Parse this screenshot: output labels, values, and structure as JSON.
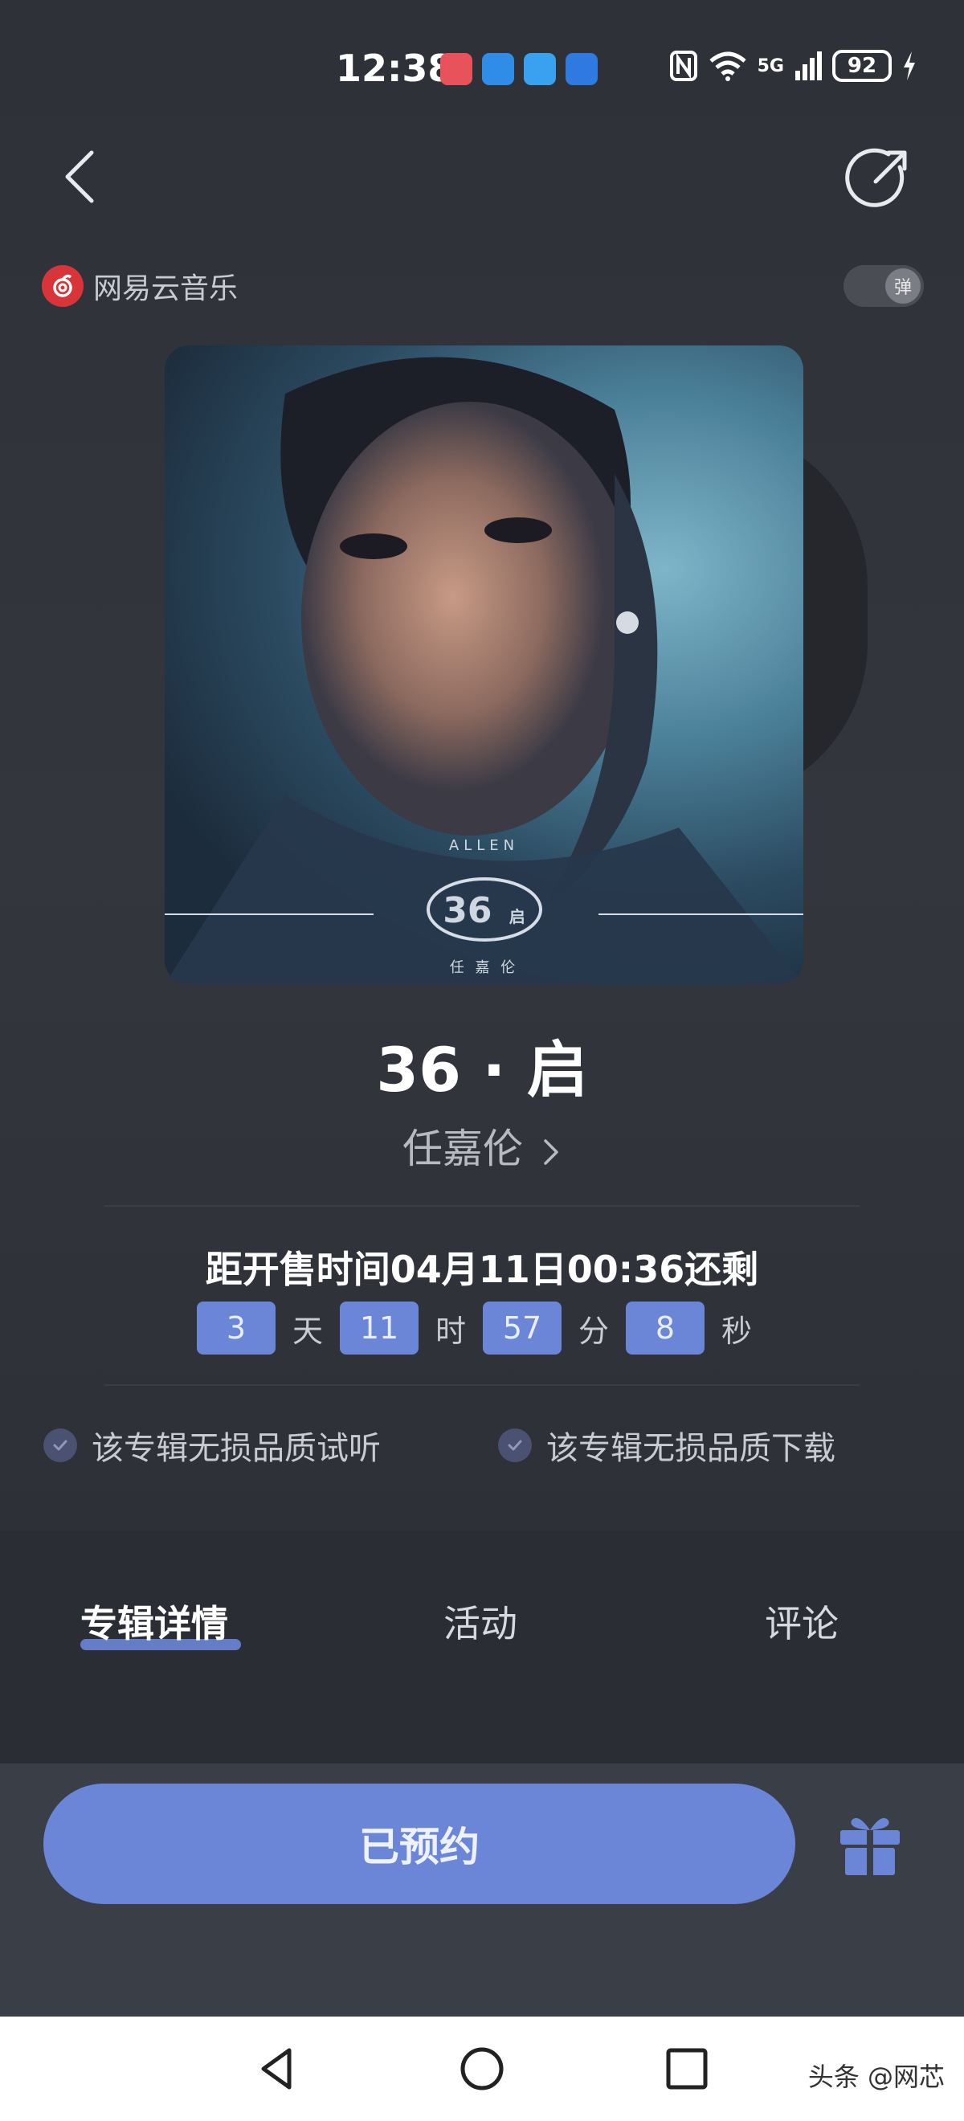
{
  "status_bar": {
    "time": "12:38",
    "battery": "92",
    "network": "5G"
  },
  "header": {
    "brand_name": "网易云音乐",
    "danmu_label": "弹"
  },
  "album": {
    "cover_top_text": "ALLEN",
    "cover_logo_text": "36",
    "cover_logo_suffix": "启",
    "cover_bottom_text": "任 嘉 伦",
    "title": "36 · 启",
    "artist": "任嘉伦"
  },
  "presale": {
    "text": "距开售时间04月11日00:36还剩",
    "countdown": [
      {
        "value": "3",
        "unit": "天"
      },
      {
        "value": "11",
        "unit": "时"
      },
      {
        "value": "57",
        "unit": "分"
      },
      {
        "value": "8",
        "unit": "秒"
      }
    ]
  },
  "quality": {
    "preview": "该专辑无损品质试听",
    "download": "该专辑无损品质下载"
  },
  "tabs": [
    {
      "label": "专辑详情",
      "active": true
    },
    {
      "label": "活动",
      "active": false
    },
    {
      "label": "评论",
      "active": false
    }
  ],
  "action": {
    "reserve_label": "已预约"
  },
  "watermark": "头条 @网芯",
  "colors": {
    "accent": "#6b86d6",
    "brand_red": "#d8353a",
    "background": "#2f3239"
  },
  "icons": [
    "back-icon",
    "share-icon",
    "netease-logo-icon",
    "gift-icon",
    "nav-back-icon",
    "nav-home-icon",
    "nav-recents-icon"
  ]
}
